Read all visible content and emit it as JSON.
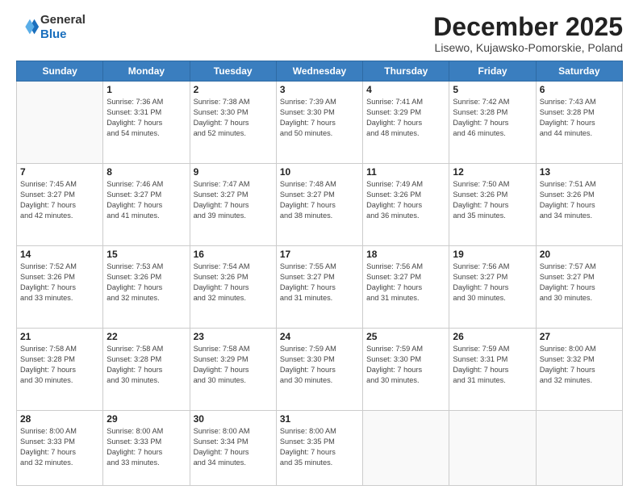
{
  "logo": {
    "general": "General",
    "blue": "Blue"
  },
  "header": {
    "month": "December 2025",
    "location": "Lisewo, Kujawsko-Pomorskie, Poland"
  },
  "weekdays": [
    "Sunday",
    "Monday",
    "Tuesday",
    "Wednesday",
    "Thursday",
    "Friday",
    "Saturday"
  ],
  "weeks": [
    [
      {
        "day": "",
        "info": ""
      },
      {
        "day": "1",
        "info": "Sunrise: 7:36 AM\nSunset: 3:31 PM\nDaylight: 7 hours\nand 54 minutes."
      },
      {
        "day": "2",
        "info": "Sunrise: 7:38 AM\nSunset: 3:30 PM\nDaylight: 7 hours\nand 52 minutes."
      },
      {
        "day": "3",
        "info": "Sunrise: 7:39 AM\nSunset: 3:30 PM\nDaylight: 7 hours\nand 50 minutes."
      },
      {
        "day": "4",
        "info": "Sunrise: 7:41 AM\nSunset: 3:29 PM\nDaylight: 7 hours\nand 48 minutes."
      },
      {
        "day": "5",
        "info": "Sunrise: 7:42 AM\nSunset: 3:28 PM\nDaylight: 7 hours\nand 46 minutes."
      },
      {
        "day": "6",
        "info": "Sunrise: 7:43 AM\nSunset: 3:28 PM\nDaylight: 7 hours\nand 44 minutes."
      }
    ],
    [
      {
        "day": "7",
        "info": "Sunrise: 7:45 AM\nSunset: 3:27 PM\nDaylight: 7 hours\nand 42 minutes."
      },
      {
        "day": "8",
        "info": "Sunrise: 7:46 AM\nSunset: 3:27 PM\nDaylight: 7 hours\nand 41 minutes."
      },
      {
        "day": "9",
        "info": "Sunrise: 7:47 AM\nSunset: 3:27 PM\nDaylight: 7 hours\nand 39 minutes."
      },
      {
        "day": "10",
        "info": "Sunrise: 7:48 AM\nSunset: 3:27 PM\nDaylight: 7 hours\nand 38 minutes."
      },
      {
        "day": "11",
        "info": "Sunrise: 7:49 AM\nSunset: 3:26 PM\nDaylight: 7 hours\nand 36 minutes."
      },
      {
        "day": "12",
        "info": "Sunrise: 7:50 AM\nSunset: 3:26 PM\nDaylight: 7 hours\nand 35 minutes."
      },
      {
        "day": "13",
        "info": "Sunrise: 7:51 AM\nSunset: 3:26 PM\nDaylight: 7 hours\nand 34 minutes."
      }
    ],
    [
      {
        "day": "14",
        "info": "Sunrise: 7:52 AM\nSunset: 3:26 PM\nDaylight: 7 hours\nand 33 minutes."
      },
      {
        "day": "15",
        "info": "Sunrise: 7:53 AM\nSunset: 3:26 PM\nDaylight: 7 hours\nand 32 minutes."
      },
      {
        "day": "16",
        "info": "Sunrise: 7:54 AM\nSunset: 3:26 PM\nDaylight: 7 hours\nand 32 minutes."
      },
      {
        "day": "17",
        "info": "Sunrise: 7:55 AM\nSunset: 3:27 PM\nDaylight: 7 hours\nand 31 minutes."
      },
      {
        "day": "18",
        "info": "Sunrise: 7:56 AM\nSunset: 3:27 PM\nDaylight: 7 hours\nand 31 minutes."
      },
      {
        "day": "19",
        "info": "Sunrise: 7:56 AM\nSunset: 3:27 PM\nDaylight: 7 hours\nand 30 minutes."
      },
      {
        "day": "20",
        "info": "Sunrise: 7:57 AM\nSunset: 3:27 PM\nDaylight: 7 hours\nand 30 minutes."
      }
    ],
    [
      {
        "day": "21",
        "info": "Sunrise: 7:58 AM\nSunset: 3:28 PM\nDaylight: 7 hours\nand 30 minutes."
      },
      {
        "day": "22",
        "info": "Sunrise: 7:58 AM\nSunset: 3:28 PM\nDaylight: 7 hours\nand 30 minutes."
      },
      {
        "day": "23",
        "info": "Sunrise: 7:58 AM\nSunset: 3:29 PM\nDaylight: 7 hours\nand 30 minutes."
      },
      {
        "day": "24",
        "info": "Sunrise: 7:59 AM\nSunset: 3:30 PM\nDaylight: 7 hours\nand 30 minutes."
      },
      {
        "day": "25",
        "info": "Sunrise: 7:59 AM\nSunset: 3:30 PM\nDaylight: 7 hours\nand 30 minutes."
      },
      {
        "day": "26",
        "info": "Sunrise: 7:59 AM\nSunset: 3:31 PM\nDaylight: 7 hours\nand 31 minutes."
      },
      {
        "day": "27",
        "info": "Sunrise: 8:00 AM\nSunset: 3:32 PM\nDaylight: 7 hours\nand 32 minutes."
      }
    ],
    [
      {
        "day": "28",
        "info": "Sunrise: 8:00 AM\nSunset: 3:33 PM\nDaylight: 7 hours\nand 32 minutes."
      },
      {
        "day": "29",
        "info": "Sunrise: 8:00 AM\nSunset: 3:33 PM\nDaylight: 7 hours\nand 33 minutes."
      },
      {
        "day": "30",
        "info": "Sunrise: 8:00 AM\nSunset: 3:34 PM\nDaylight: 7 hours\nand 34 minutes."
      },
      {
        "day": "31",
        "info": "Sunrise: 8:00 AM\nSunset: 3:35 PM\nDaylight: 7 hours\nand 35 minutes."
      },
      {
        "day": "",
        "info": ""
      },
      {
        "day": "",
        "info": ""
      },
      {
        "day": "",
        "info": ""
      }
    ]
  ]
}
